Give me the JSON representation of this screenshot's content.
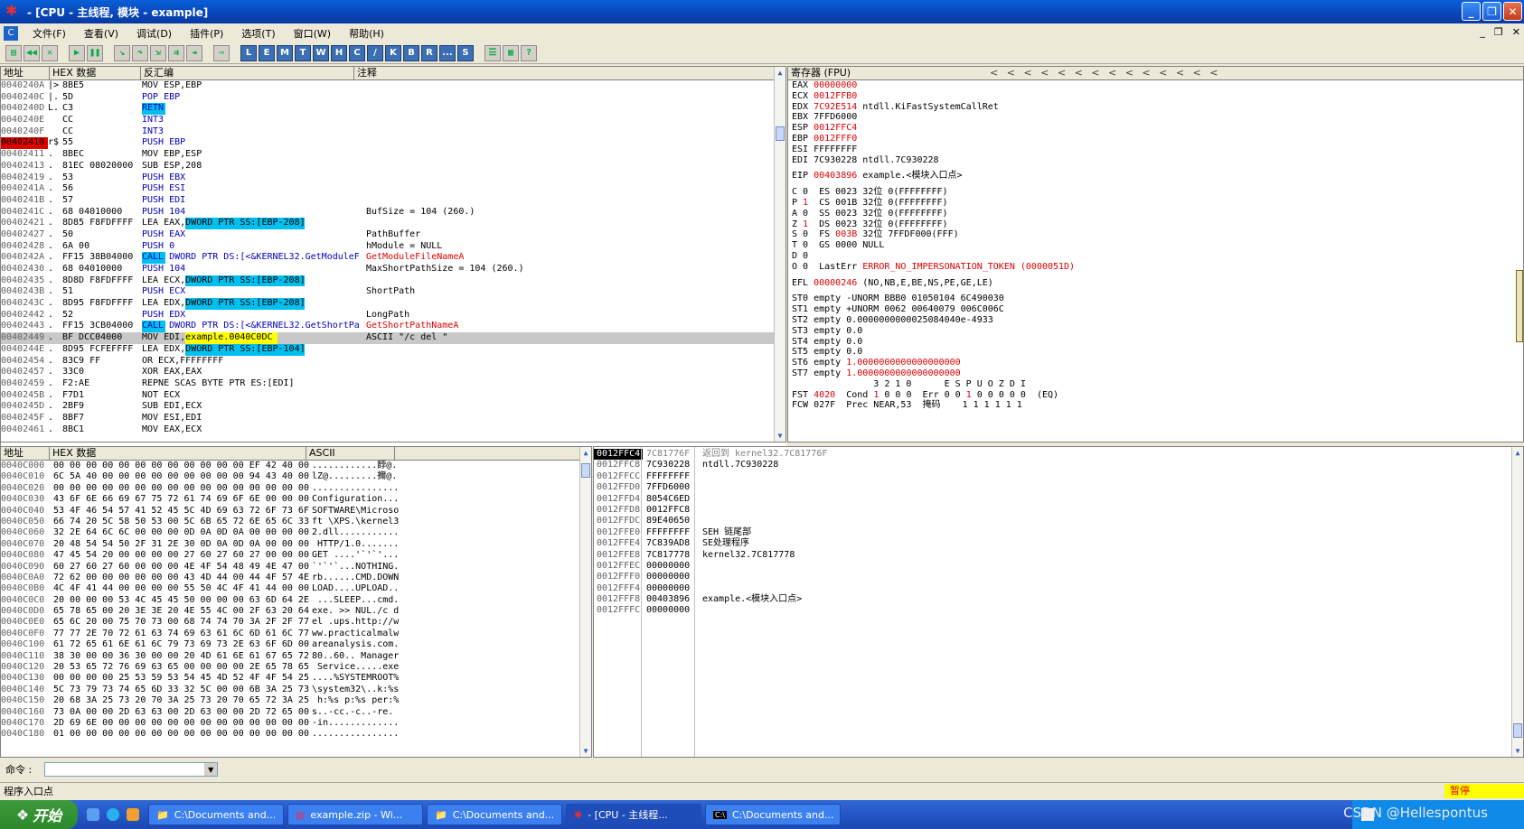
{
  "window": {
    "title": "- [CPU - 主线程, 模块 - example]",
    "controls": [
      "_",
      "❐",
      "✕"
    ]
  },
  "menu": {
    "items": [
      "文件(F)",
      "查看(V)",
      "调试(D)",
      "插件(P)",
      "选项(T)",
      "窗口(W)",
      "帮助(H)"
    ],
    "mdi_controls": [
      "_",
      "❐",
      "✕"
    ]
  },
  "toolbar": {
    "letter_buttons": [
      "L",
      "E",
      "M",
      "T",
      "W",
      "H",
      "C",
      "/",
      "K",
      "B",
      "R",
      "...",
      "S"
    ]
  },
  "disasm": {
    "headers": [
      "地址",
      "HEX 数据",
      "反汇编",
      "注释"
    ],
    "rows": [
      {
        "addr": "0040240A",
        "mark": "|>",
        "hex": "8BE5",
        "dis": "MOV ESP,EBP",
        "com": ""
      },
      {
        "addr": "0040240C",
        "mark": "|.",
        "hex": "5D",
        "dis": "POP EBP",
        "com": ""
      },
      {
        "addr": "0040240D",
        "mark": "L.",
        "hex": "C3",
        "dis": "RETN",
        "com": ""
      },
      {
        "addr": "0040240E",
        "mark": "",
        "hex": "CC",
        "dis": "INT3",
        "com": ""
      },
      {
        "addr": "0040240F",
        "mark": "",
        "hex": "CC",
        "dis": "INT3",
        "com": ""
      },
      {
        "addr": "00402410",
        "mark": "r$",
        "hex": "55",
        "dis": "PUSH EBP",
        "com": ""
      },
      {
        "addr": "00402411",
        "mark": ".",
        "hex": "8BEC",
        "dis": "MOV EBP,ESP",
        "com": ""
      },
      {
        "addr": "00402413",
        "mark": ".",
        "hex": "81EC 08020000",
        "dis": "SUB ESP,208",
        "com": ""
      },
      {
        "addr": "00402419",
        "mark": ".",
        "hex": "53",
        "dis": "PUSH EBX",
        "com": ""
      },
      {
        "addr": "0040241A",
        "mark": ".",
        "hex": "56",
        "dis": "PUSH ESI",
        "com": ""
      },
      {
        "addr": "0040241B",
        "mark": ".",
        "hex": "57",
        "dis": "PUSH EDI",
        "com": ""
      },
      {
        "addr": "0040241C",
        "mark": ".",
        "hex": "68 04010000",
        "dis": "PUSH 104",
        "com": "BufSize = 104 (260.)"
      },
      {
        "addr": "00402421",
        "mark": ".",
        "hex": "8D85 F8FDFFFF",
        "dis": "LEA EAX,DWORD PTR SS:[EBP-208]",
        "com": ""
      },
      {
        "addr": "00402427",
        "mark": ".",
        "hex": "50",
        "dis": "PUSH EAX",
        "com": "PathBuffer"
      },
      {
        "addr": "00402428",
        "mark": ".",
        "hex": "6A 00",
        "dis": "PUSH 0",
        "com": "hModule = NULL"
      },
      {
        "addr": "0040242A",
        "mark": ".",
        "hex": "FF15 38B04000",
        "dis": "CALL DWORD PTR DS:[<&KERNEL32.GetModuleF",
        "com": "GetModuleFileNameA"
      },
      {
        "addr": "00402430",
        "mark": ".",
        "hex": "68 04010000",
        "dis": "PUSH 104",
        "com": "MaxShortPathSize = 104 (260.)"
      },
      {
        "addr": "00402435",
        "mark": ".",
        "hex": "8D8D F8FDFFFF",
        "dis": "LEA ECX,DWORD PTR SS:[EBP-208]",
        "com": ""
      },
      {
        "addr": "0040243B",
        "mark": ".",
        "hex": "51",
        "dis": "PUSH ECX",
        "com": "ShortPath"
      },
      {
        "addr": "0040243C",
        "mark": ".",
        "hex": "8D95 F8FDFFFF",
        "dis": "LEA EDX,DWORD PTR SS:[EBP-208]",
        "com": ""
      },
      {
        "addr": "00402442",
        "mark": ".",
        "hex": "52",
        "dis": "PUSH EDX",
        "com": "LongPath"
      },
      {
        "addr": "00402443",
        "mark": ".",
        "hex": "FF15 3CB04000",
        "dis": "CALL DWORD PTR DS:[<&KERNEL32.GetShortPa",
        "com": "GetShortPathNameA"
      },
      {
        "addr": "00402449",
        "mark": ".",
        "hex": "BF DCC04000",
        "dis": "MOV EDI,example.0040C0DC",
        "com": "ASCII \"/c del \""
      },
      {
        "addr": "0040244E",
        "mark": ".",
        "hex": "8D95 FCFEFFFF",
        "dis": "LEA EDX,DWORD PTR SS:[EBP-104]",
        "com": ""
      },
      {
        "addr": "00402454",
        "mark": ".",
        "hex": "83C9 FF",
        "dis": "OR ECX,FFFFFFFF",
        "com": ""
      },
      {
        "addr": "00402457",
        "mark": ".",
        "hex": "33C0",
        "dis": "XOR EAX,EAX",
        "com": ""
      },
      {
        "addr": "00402459",
        "mark": ".",
        "hex": "F2:AE",
        "dis": "REPNE SCAS BYTE PTR ES:[EDI]",
        "com": ""
      },
      {
        "addr": "0040245B",
        "mark": ".",
        "hex": "F7D1",
        "dis": "NOT ECX",
        "com": ""
      },
      {
        "addr": "0040245D",
        "mark": ".",
        "hex": "2BF9",
        "dis": "SUB EDI,ECX",
        "com": ""
      },
      {
        "addr": "0040245F",
        "mark": ".",
        "hex": "8BF7",
        "dis": "MOV ESI,EDI",
        "com": ""
      },
      {
        "addr": "00402461",
        "mark": ".",
        "hex": "8BC1",
        "dis": "MOV EAX,ECX",
        "com": ""
      }
    ]
  },
  "registers": {
    "header": "寄存器 (FPU)",
    "arrows": "<  <  <  <  <  <  <  <  <  <  <  <  <  <",
    "lines": [
      [
        {
          "t": "EAX "
        },
        {
          "t": "00000000",
          "c": "red"
        }
      ],
      [
        {
          "t": "ECX "
        },
        {
          "t": "0012FFB0",
          "c": "red"
        }
      ],
      [
        {
          "t": "EDX "
        },
        {
          "t": "7C92E514",
          "c": "red"
        },
        {
          "t": " ntdll.KiFastSystemCallRet"
        }
      ],
      [
        {
          "t": "EBX 7FFD6000"
        }
      ],
      [
        {
          "t": "ESP "
        },
        {
          "t": "0012FFC4",
          "c": "red"
        }
      ],
      [
        {
          "t": "EBP "
        },
        {
          "t": "0012FFF0",
          "c": "red"
        }
      ],
      [
        {
          "t": "ESI FFFFFFFF"
        }
      ],
      [
        {
          "t": "EDI 7C930228 ntdll.7C930228"
        }
      ],
      [
        {
          "gap": true
        }
      ],
      [
        {
          "t": "EIP "
        },
        {
          "t": "00403896",
          "c": "red"
        },
        {
          "t": " example.<模块入口点>"
        }
      ],
      [
        {
          "gap": true
        }
      ],
      [
        {
          "t": "C 0  ES 0023 32位 0(FFFFFFFF)"
        }
      ],
      [
        {
          "t": "P "
        },
        {
          "t": "1",
          "c": "red"
        },
        {
          "t": "  CS 001B 32位 0(FFFFFFFF)"
        }
      ],
      [
        {
          "t": "A 0  SS 0023 32位 0(FFFFFFFF)"
        }
      ],
      [
        {
          "t": "Z "
        },
        {
          "t": "1",
          "c": "red"
        },
        {
          "t": "  DS 0023 32位 0(FFFFFFFF)"
        }
      ],
      [
        {
          "t": "S 0  FS "
        },
        {
          "t": "003B",
          "c": "red"
        },
        {
          "t": " 32位 7FFDF000(FFF)"
        }
      ],
      [
        {
          "t": "T 0  GS 0000 NULL"
        }
      ],
      [
        {
          "t": "D 0"
        }
      ],
      [
        {
          "t": "O 0  LastErr "
        },
        {
          "t": "ERROR_NO_IMPERSONATION_TOKEN (0000051D)",
          "c": "red"
        }
      ],
      [
        {
          "gap": true
        }
      ],
      [
        {
          "t": "EFL "
        },
        {
          "t": "00000246",
          "c": "red"
        },
        {
          "t": " (NO,NB,E,BE,NS,PE,GE,LE)"
        }
      ],
      [
        {
          "gap": true
        }
      ],
      [
        {
          "t": "ST0 empty -UNORM BBB0 01050104 6C490030"
        }
      ],
      [
        {
          "t": "ST1 empty +UNORM 0062 00640079 006C006C"
        }
      ],
      [
        {
          "t": "ST2 empty 0.0000000000025084040e-4933"
        }
      ],
      [
        {
          "t": "ST3 empty 0.0"
        }
      ],
      [
        {
          "t": "ST4 empty 0.0"
        }
      ],
      [
        {
          "t": "ST5 empty 0.0"
        }
      ],
      [
        {
          "t": "ST6 empty "
        },
        {
          "t": "1.0000000000000000000",
          "c": "red"
        }
      ],
      [
        {
          "t": "ST7 empty "
        },
        {
          "t": "1.0000000000000000000",
          "c": "red"
        }
      ],
      [
        {
          "t": "               3 2 1 0      E S P U O Z D I"
        }
      ],
      [
        {
          "t": "FST "
        },
        {
          "t": "4020",
          "c": "red"
        },
        {
          "t": "  Cond "
        },
        {
          "t": "1",
          "c": "red"
        },
        {
          "t": " 0 0 0  Err 0 0 "
        },
        {
          "t": "1",
          "c": "red"
        },
        {
          "t": " 0 0 0 0 0  (EQ)"
        }
      ],
      [
        {
          "t": "FCW 027F  Prec NEAR,53  掩码    1 1 1 1 1 1"
        }
      ]
    ]
  },
  "dump": {
    "headers": [
      "地址",
      "HEX 数据",
      "ASCII"
    ],
    "rows": [
      [
        "0040C000",
        "00 00 00 00 00 00 00 00 00 00 00 00 EF 42 40 00",
        "............餑@."
      ],
      [
        "0040C010",
        "6C 5A 40 00 00 00 00 00 00 00 00 00 94 43 40 00",
        "lZ@.........擟@."
      ],
      [
        "0040C020",
        "00 00 00 00 00 00 00 00 00 00 00 00 00 00 00 00",
        "................"
      ],
      [
        "0040C030",
        "43 6F 6E 66 69 67 75 72 61 74 69 6F 6E 00 00 00",
        "Configuration..."
      ],
      [
        "0040C040",
        "53 4F 46 54 57 41 52 45 5C 4D 69 63 72 6F 73 6F",
        "SOFTWARE\\Microso"
      ],
      [
        "0040C050",
        "66 74 20 5C 58 50 53 00 5C 6B 65 72 6E 65 6C 33",
        "ft \\XPS.\\kernel3"
      ],
      [
        "0040C060",
        "32 2E 64 6C 6C 00 00 00 0D 0A 0D 0A 00 00 00 00",
        "2.dll..........."
      ],
      [
        "0040C070",
        "20 48 54 54 50 2F 31 2E 30 0D 0A 0D 0A 00 00 00",
        " HTTP/1.0......."
      ],
      [
        "0040C080",
        "47 45 54 20 00 00 00 00 27 60 27 60 27 00 00 00",
        "GET ....'`'`'..."
      ],
      [
        "0040C090",
        "60 27 60 27 60 00 00 00 4E 4F 54 48 49 4E 47 00",
        "`'`'`...NOTHING."
      ],
      [
        "0040C0A0",
        "72 62 00 00 00 00 00 00 43 4D 44 00 44 4F 57 4E",
        "rb......CMD.DOWN"
      ],
      [
        "0040C0B0",
        "4C 4F 41 44 00 00 00 00 55 50 4C 4F 41 44 00 00",
        "LOAD....UPLOAD.."
      ],
      [
        "0040C0C0",
        "20 00 00 00 53 4C 45 45 50 00 00 00 63 6D 64 2E",
        " ...SLEEP...cmd."
      ],
      [
        "0040C0D0",
        "65 78 65 00 20 3E 3E 20 4E 55 4C 00 2F 63 20 64",
        "exe. >> NUL./c d"
      ],
      [
        "0040C0E0",
        "65 6C 20 00 75 70 73 00 68 74 74 70 3A 2F 2F 77",
        "el .ups.http://w"
      ],
      [
        "0040C0F0",
        "77 77 2E 70 72 61 63 74 69 63 61 6C 6D 61 6C 77",
        "ww.practicalmalw"
      ],
      [
        "0040C100",
        "61 72 65 61 6E 61 6C 79 73 69 73 2E 63 6F 6D 00",
        "areanalysis.com."
      ],
      [
        "0040C110",
        "38 30 00 00 36 30 00 00 20 4D 61 6E 61 67 65 72",
        "80..60.. Manager"
      ],
      [
        "0040C120",
        "20 53 65 72 76 69 63 65 00 00 00 00 2E 65 78 65",
        " Service.....exe"
      ],
      [
        "0040C130",
        "00 00 00 00 25 53 59 53 54 45 4D 52 4F 4F 54 25",
        "....%SYSTEMROOT%"
      ],
      [
        "0040C140",
        "5C 73 79 73 74 65 6D 33 32 5C 00 00 6B 3A 25 73",
        "\\system32\\..k:%s"
      ],
      [
        "0040C150",
        "20 68 3A 25 73 20 70 3A 25 73 20 70 65 72 3A 25",
        " h:%s p:%s per:%"
      ],
      [
        "0040C160",
        "73 0A 00 00 2D 63 63 00 2D 63 00 00 2D 72 65 00",
        "s..-cc.-c..-re."
      ],
      [
        "0040C170",
        "2D 69 6E 00 00 00 00 00 00 00 00 00 00 00 00 00",
        "-in............."
      ],
      [
        "0040C180",
        "01 00 00 00 00 00 00 00 00 00 00 00 00 00 00 00",
        "................"
      ]
    ]
  },
  "stack": {
    "rows": [
      [
        "0012FFC4",
        "7C81776F",
        "返回到 kernel32.7C81776F"
      ],
      [
        "0012FFC8",
        "7C930228",
        "ntdll.7C930228"
      ],
      [
        "0012FFCC",
        "FFFFFFFF",
        ""
      ],
      [
        "0012FFD0",
        "7FFD6000",
        ""
      ],
      [
        "0012FFD4",
        "8054C6ED",
        ""
      ],
      [
        "0012FFD8",
        "0012FFC8",
        ""
      ],
      [
        "0012FFDC",
        "89E40650",
        ""
      ],
      [
        "0012FFE0",
        "FFFFFFFF",
        "SEH 链尾部"
      ],
      [
        "0012FFE4",
        "7C839AD8",
        "SE处理程序"
      ],
      [
        "0012FFE8",
        "7C817778",
        "kernel32.7C817778"
      ],
      [
        "0012FFEC",
        "00000000",
        ""
      ],
      [
        "0012FFF0",
        "00000000",
        ""
      ],
      [
        "0012FFF4",
        "00000000",
        ""
      ],
      [
        "0012FFF8",
        "00403896",
        "example.<模块入口点>"
      ],
      [
        "0012FFFC",
        "00000000",
        ""
      ]
    ]
  },
  "command": {
    "label": "命令 :",
    "value": ""
  },
  "status": {
    "text": "程序入口点",
    "state": "暂停"
  },
  "taskbar": {
    "start": "开始",
    "tasks": [
      "C:\\Documents and...",
      "example.zip - Wi...",
      "C:\\Documents and...",
      "- [CPU - 主线程...",
      "C:\\Documents and..."
    ],
    "watermark": "CSDN @Hellespontus"
  }
}
